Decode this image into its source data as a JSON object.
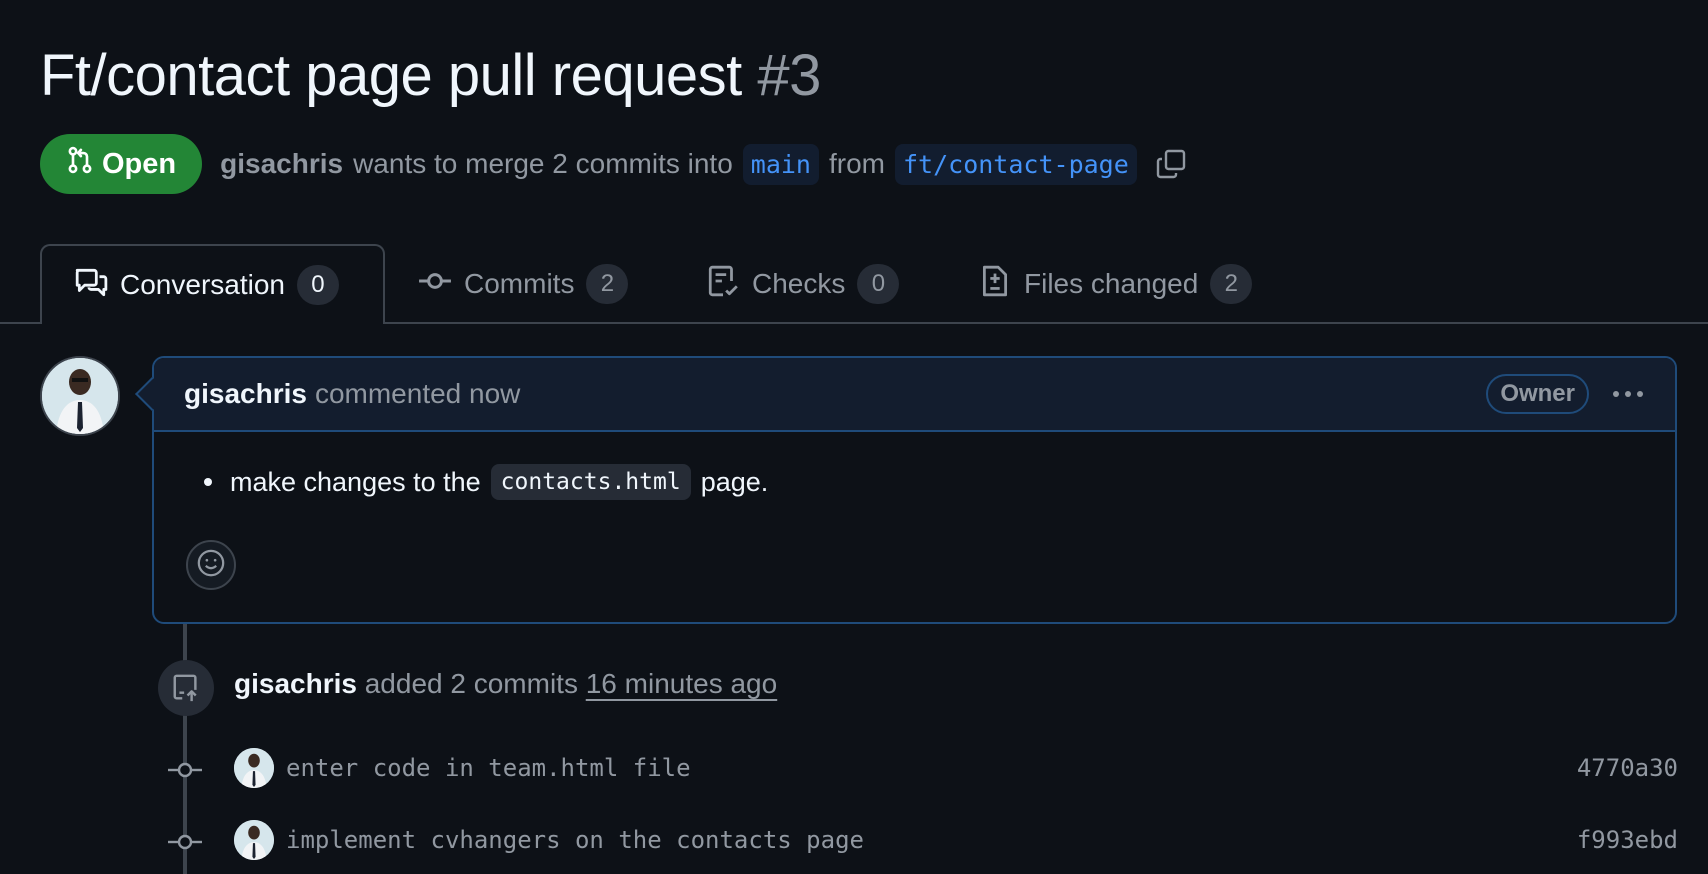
{
  "pr": {
    "title": "Ft/contact page pull request",
    "number": "#3",
    "state_label": "Open",
    "author": "gisachris",
    "summary_mid": "wants to merge 2 commits into",
    "base_branch": "main",
    "from_word": "from",
    "head_branch": "ft/contact-page"
  },
  "tabs": [
    {
      "label": "Conversation",
      "count": "0"
    },
    {
      "label": "Commits",
      "count": "2"
    },
    {
      "label": "Checks",
      "count": "0"
    },
    {
      "label": "Files changed",
      "count": "2"
    }
  ],
  "comment": {
    "author": "gisachris",
    "time": "commented now",
    "badge": "Owner",
    "body_before": "make changes to the",
    "body_code": "contacts.html",
    "body_after": "page."
  },
  "timeline": {
    "author": "gisachris",
    "action": "added 2 commits",
    "time": "16 minutes ago",
    "commits": [
      {
        "message": "enter code in team.html file",
        "sha": "4770a30"
      },
      {
        "message": "implement cvhangers on the contacts page",
        "sha": "f993ebd"
      }
    ]
  },
  "colors": {
    "background": "#0d1117",
    "open_green": "#238636",
    "link_blue": "#4493f8",
    "muted_text": "#9198a1"
  }
}
